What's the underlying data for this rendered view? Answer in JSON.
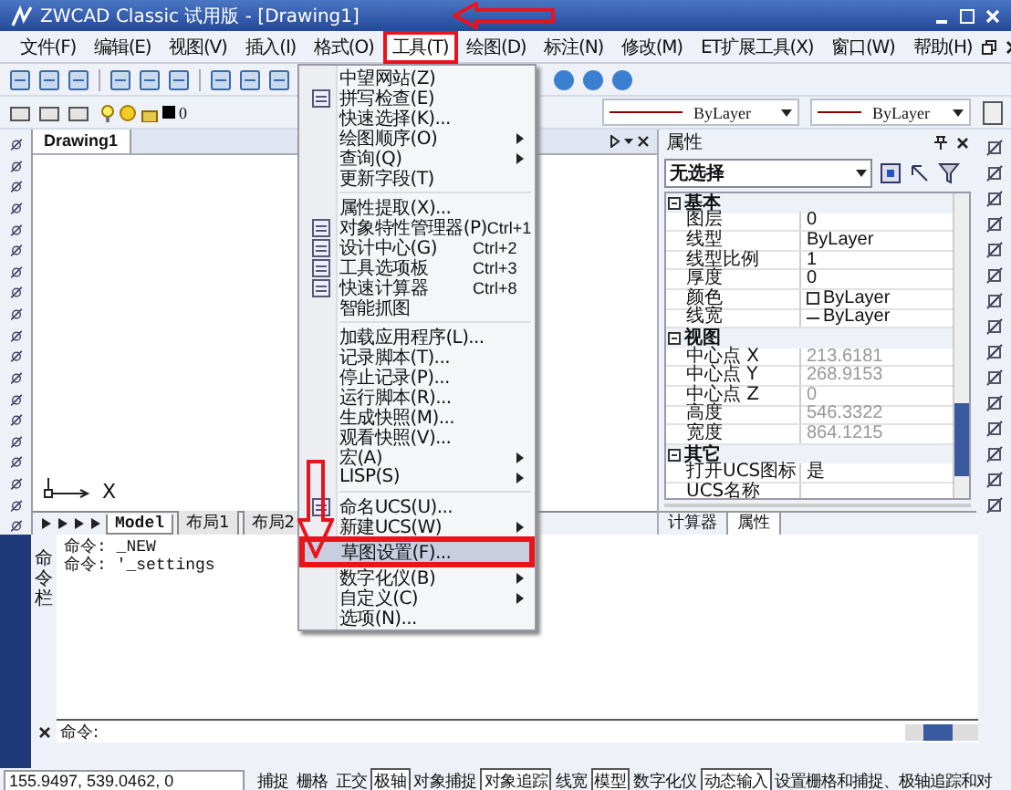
{
  "window": {
    "title": "ZWCAD Classic 试用版 - [Drawing1]"
  },
  "menubar": [
    {
      "label": "文件(F)",
      "selected": false
    },
    {
      "label": "编辑(E)",
      "selected": false
    },
    {
      "label": "视图(V)",
      "selected": false
    },
    {
      "label": "插入(I)",
      "selected": false
    },
    {
      "label": "格式(O)",
      "selected": false
    },
    {
      "label": "工具(T)",
      "selected": true
    },
    {
      "label": "绘图(D)",
      "selected": false
    },
    {
      "label": "标注(N)",
      "selected": false
    },
    {
      "label": "修改(M)",
      "selected": false
    },
    {
      "label": "ET扩展工具(X)",
      "selected": false
    },
    {
      "label": "窗口(W)",
      "selected": false
    },
    {
      "label": "帮助(H)",
      "selected": false
    }
  ],
  "toolbar": {
    "layer": "0",
    "linetype": "ByLayer",
    "lineweight": "ByLayer"
  },
  "tools_menu": [
    {
      "kind": "item",
      "label": "中望网站(Z)",
      "submenu": false,
      "selected": false
    },
    {
      "kind": "item",
      "label": "拼写检查(E)",
      "submenu": false,
      "selected": false
    },
    {
      "kind": "item",
      "label": "快速选择(K)...",
      "submenu": false,
      "selected": false
    },
    {
      "kind": "item",
      "label": "绘图顺序(O)",
      "submenu": true,
      "selected": false
    },
    {
      "kind": "item",
      "label": "查询(Q)",
      "submenu": true,
      "selected": false
    },
    {
      "kind": "item",
      "label": "更新字段(T)",
      "submenu": false,
      "selected": false
    },
    {
      "kind": "separator"
    },
    {
      "kind": "item",
      "label": "属性提取(X)...",
      "submenu": false,
      "selected": false
    },
    {
      "kind": "item",
      "label": "对象特性管理器(P)",
      "shortcut": "Ctrl+1",
      "submenu": false,
      "selected": false
    },
    {
      "kind": "item",
      "label": "设计中心(G)",
      "shortcut": "Ctrl+2",
      "submenu": false,
      "selected": false
    },
    {
      "kind": "item",
      "label": "工具选项板",
      "shortcut": "Ctrl+3",
      "submenu": false,
      "selected": false
    },
    {
      "kind": "item",
      "label": "快速计算器",
      "shortcut": "Ctrl+8",
      "submenu": false,
      "selected": false
    },
    {
      "kind": "item",
      "label": "智能抓图",
      "submenu": false,
      "selected": false
    },
    {
      "kind": "separator"
    },
    {
      "kind": "item",
      "label": "加载应用程序(L)...",
      "submenu": false,
      "selected": false
    },
    {
      "kind": "item",
      "label": "记录脚本(T)...",
      "submenu": false,
      "selected": false
    },
    {
      "kind": "item",
      "label": "停止记录(P)...",
      "submenu": false,
      "selected": false
    },
    {
      "kind": "item",
      "label": "运行脚本(R)...",
      "submenu": false,
      "selected": false
    },
    {
      "kind": "item",
      "label": "生成快照(M)...",
      "submenu": false,
      "selected": false
    },
    {
      "kind": "item",
      "label": "观看快照(V)...",
      "submenu": false,
      "selected": false
    },
    {
      "kind": "item",
      "label": "宏(A)",
      "submenu": true,
      "selected": false
    },
    {
      "kind": "item",
      "label": "LISP(S)",
      "submenu": true,
      "selected": false
    },
    {
      "kind": "separator"
    },
    {
      "kind": "item",
      "label": "命名UCS(U)...",
      "submenu": false,
      "selected": false
    },
    {
      "kind": "item",
      "label": "新建UCS(W)",
      "submenu": true,
      "selected": false
    },
    {
      "kind": "item",
      "label": "草图设置(F)...",
      "submenu": false,
      "selected": true
    },
    {
      "kind": "item",
      "label": "数字化仪(B)",
      "submenu": true,
      "selected": false
    },
    {
      "kind": "item",
      "label": "自定义(C)",
      "submenu": true,
      "selected": false
    },
    {
      "kind": "item",
      "label": "选项(N)...",
      "submenu": false,
      "selected": false
    }
  ],
  "drawing": {
    "tab": "Drawing1",
    "ucs_label": "X",
    "layout_tabs": [
      {
        "label": "Model",
        "selected": true
      },
      {
        "label": "布局1",
        "selected": false
      },
      {
        "label": "布局2",
        "selected": false
      }
    ]
  },
  "properties": {
    "title": "属性",
    "selection": "无选择",
    "groups": [
      {
        "name": "基本",
        "expanded": true,
        "rows": [
          {
            "name": "图层",
            "value": "0",
            "disabled": false
          },
          {
            "name": "线型",
            "value": "ByLayer",
            "disabled": false
          },
          {
            "name": "线型比例",
            "value": "1",
            "disabled": false
          },
          {
            "name": "厚度",
            "value": "0",
            "disabled": false
          },
          {
            "name": "颜色",
            "value": "ByLayer",
            "disabled": false
          },
          {
            "name": "线宽",
            "value": "ByLayer",
            "disabled": false
          }
        ]
      },
      {
        "name": "视图",
        "expanded": true,
        "rows": [
          {
            "name": "中心点 X",
            "value": "213.6181",
            "disabled": true
          },
          {
            "name": "中心点 Y",
            "value": "268.9153",
            "disabled": true
          },
          {
            "name": "中心点 Z",
            "value": "0",
            "disabled": true
          },
          {
            "name": "高度",
            "value": "546.3322",
            "disabled": true
          },
          {
            "name": "宽度",
            "value": "864.1215",
            "disabled": true
          }
        ]
      },
      {
        "name": "其它",
        "expanded": true,
        "rows": [
          {
            "name": "打开UCS图标",
            "value": "是",
            "disabled": false
          },
          {
            "name": "UCS名称",
            "disabled": false
          }
        ]
      }
    ],
    "tabs": [
      {
        "label": "计算器",
        "selected": false
      },
      {
        "label": "属性",
        "selected": true
      }
    ]
  },
  "command": {
    "label": "命令栏",
    "history": [
      "命令: _NEW",
      "命令: '_settings"
    ],
    "prompt": "命令:"
  },
  "status_bar": {
    "coords": "155.9497, 539.0462, 0",
    "toggles": [
      {
        "label": "捕捉",
        "on": false
      },
      {
        "label": "栅格",
        "on": false
      },
      {
        "label": "正交",
        "on": false
      },
      {
        "label": "极轴",
        "on": true
      },
      {
        "label": "对象捕捉",
        "on": false
      },
      {
        "label": "对象追踪",
        "on": true
      },
      {
        "label": "线宽",
        "on": false
      },
      {
        "label": "模型",
        "on": true
      },
      {
        "label": "数字化仪",
        "on": false
      },
      {
        "label": "动态输入",
        "on": true
      }
    ],
    "message": "设置栅格和捕捉、极轴追踪和对"
  }
}
